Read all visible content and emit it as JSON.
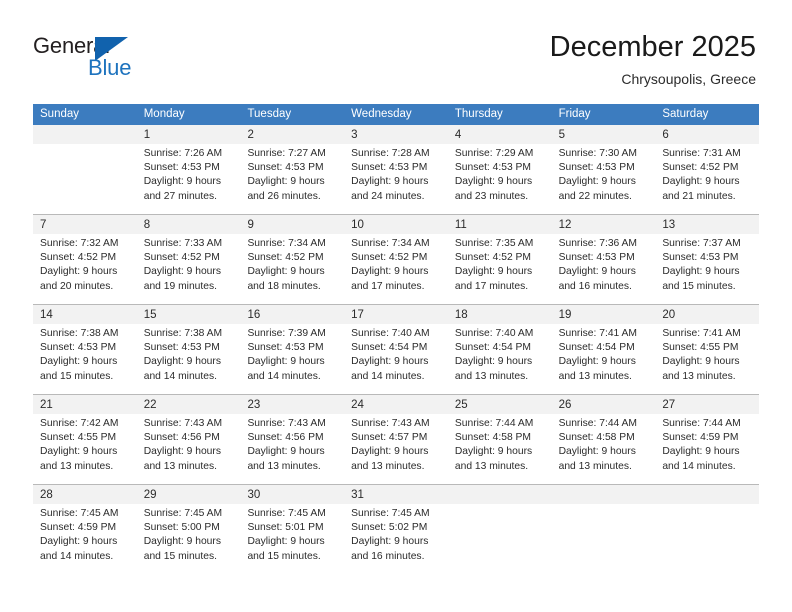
{
  "logo": {
    "text_primary": "General",
    "text_secondary": "Blue",
    "triangle_icon": "triangle-icon",
    "brand_blue": "#1e73be",
    "brand_dark": "#231f20"
  },
  "header": {
    "title": "December 2025",
    "subtitle": "Chrysoupolis, Greece"
  },
  "theme": {
    "header_row_bg": "#3c7cbf",
    "header_row_text": "#ffffff",
    "day_band_bg": "#f2f2f2",
    "grid_line": "#b9b9b9",
    "body_text": "#2b2b2b"
  },
  "calendar": {
    "day_headers": [
      "Sunday",
      "Monday",
      "Tuesday",
      "Wednesday",
      "Thursday",
      "Friday",
      "Saturday"
    ],
    "weeks": [
      [
        {
          "day": "",
          "lines": []
        },
        {
          "day": "1",
          "lines": [
            "Sunrise: 7:26 AM",
            "Sunset: 4:53 PM",
            "Daylight: 9 hours",
            "and 27 minutes."
          ]
        },
        {
          "day": "2",
          "lines": [
            "Sunrise: 7:27 AM",
            "Sunset: 4:53 PM",
            "Daylight: 9 hours",
            "and 26 minutes."
          ]
        },
        {
          "day": "3",
          "lines": [
            "Sunrise: 7:28 AM",
            "Sunset: 4:53 PM",
            "Daylight: 9 hours",
            "and 24 minutes."
          ]
        },
        {
          "day": "4",
          "lines": [
            "Sunrise: 7:29 AM",
            "Sunset: 4:53 PM",
            "Daylight: 9 hours",
            "and 23 minutes."
          ]
        },
        {
          "day": "5",
          "lines": [
            "Sunrise: 7:30 AM",
            "Sunset: 4:53 PM",
            "Daylight: 9 hours",
            "and 22 minutes."
          ]
        },
        {
          "day": "6",
          "lines": [
            "Sunrise: 7:31 AM",
            "Sunset: 4:52 PM",
            "Daylight: 9 hours",
            "and 21 minutes."
          ]
        }
      ],
      [
        {
          "day": "7",
          "lines": [
            "Sunrise: 7:32 AM",
            "Sunset: 4:52 PM",
            "Daylight: 9 hours",
            "and 20 minutes."
          ]
        },
        {
          "day": "8",
          "lines": [
            "Sunrise: 7:33 AM",
            "Sunset: 4:52 PM",
            "Daylight: 9 hours",
            "and 19 minutes."
          ]
        },
        {
          "day": "9",
          "lines": [
            "Sunrise: 7:34 AM",
            "Sunset: 4:52 PM",
            "Daylight: 9 hours",
            "and 18 minutes."
          ]
        },
        {
          "day": "10",
          "lines": [
            "Sunrise: 7:34 AM",
            "Sunset: 4:52 PM",
            "Daylight: 9 hours",
            "and 17 minutes."
          ]
        },
        {
          "day": "11",
          "lines": [
            "Sunrise: 7:35 AM",
            "Sunset: 4:52 PM",
            "Daylight: 9 hours",
            "and 17 minutes."
          ]
        },
        {
          "day": "12",
          "lines": [
            "Sunrise: 7:36 AM",
            "Sunset: 4:53 PM",
            "Daylight: 9 hours",
            "and 16 minutes."
          ]
        },
        {
          "day": "13",
          "lines": [
            "Sunrise: 7:37 AM",
            "Sunset: 4:53 PM",
            "Daylight: 9 hours",
            "and 15 minutes."
          ]
        }
      ],
      [
        {
          "day": "14",
          "lines": [
            "Sunrise: 7:38 AM",
            "Sunset: 4:53 PM",
            "Daylight: 9 hours",
            "and 15 minutes."
          ]
        },
        {
          "day": "15",
          "lines": [
            "Sunrise: 7:38 AM",
            "Sunset: 4:53 PM",
            "Daylight: 9 hours",
            "and 14 minutes."
          ]
        },
        {
          "day": "16",
          "lines": [
            "Sunrise: 7:39 AM",
            "Sunset: 4:53 PM",
            "Daylight: 9 hours",
            "and 14 minutes."
          ]
        },
        {
          "day": "17",
          "lines": [
            "Sunrise: 7:40 AM",
            "Sunset: 4:54 PM",
            "Daylight: 9 hours",
            "and 14 minutes."
          ]
        },
        {
          "day": "18",
          "lines": [
            "Sunrise: 7:40 AM",
            "Sunset: 4:54 PM",
            "Daylight: 9 hours",
            "and 13 minutes."
          ]
        },
        {
          "day": "19",
          "lines": [
            "Sunrise: 7:41 AM",
            "Sunset: 4:54 PM",
            "Daylight: 9 hours",
            "and 13 minutes."
          ]
        },
        {
          "day": "20",
          "lines": [
            "Sunrise: 7:41 AM",
            "Sunset: 4:55 PM",
            "Daylight: 9 hours",
            "and 13 minutes."
          ]
        }
      ],
      [
        {
          "day": "21",
          "lines": [
            "Sunrise: 7:42 AM",
            "Sunset: 4:55 PM",
            "Daylight: 9 hours",
            "and 13 minutes."
          ]
        },
        {
          "day": "22",
          "lines": [
            "Sunrise: 7:43 AM",
            "Sunset: 4:56 PM",
            "Daylight: 9 hours",
            "and 13 minutes."
          ]
        },
        {
          "day": "23",
          "lines": [
            "Sunrise: 7:43 AM",
            "Sunset: 4:56 PM",
            "Daylight: 9 hours",
            "and 13 minutes."
          ]
        },
        {
          "day": "24",
          "lines": [
            "Sunrise: 7:43 AM",
            "Sunset: 4:57 PM",
            "Daylight: 9 hours",
            "and 13 minutes."
          ]
        },
        {
          "day": "25",
          "lines": [
            "Sunrise: 7:44 AM",
            "Sunset: 4:58 PM",
            "Daylight: 9 hours",
            "and 13 minutes."
          ]
        },
        {
          "day": "26",
          "lines": [
            "Sunrise: 7:44 AM",
            "Sunset: 4:58 PM",
            "Daylight: 9 hours",
            "and 13 minutes."
          ]
        },
        {
          "day": "27",
          "lines": [
            "Sunrise: 7:44 AM",
            "Sunset: 4:59 PM",
            "Daylight: 9 hours",
            "and 14 minutes."
          ]
        }
      ],
      [
        {
          "day": "28",
          "lines": [
            "Sunrise: 7:45 AM",
            "Sunset: 4:59 PM",
            "Daylight: 9 hours",
            "and 14 minutes."
          ]
        },
        {
          "day": "29",
          "lines": [
            "Sunrise: 7:45 AM",
            "Sunset: 5:00 PM",
            "Daylight: 9 hours",
            "and 15 minutes."
          ]
        },
        {
          "day": "30",
          "lines": [
            "Sunrise: 7:45 AM",
            "Sunset: 5:01 PM",
            "Daylight: 9 hours",
            "and 15 minutes."
          ]
        },
        {
          "day": "31",
          "lines": [
            "Sunrise: 7:45 AM",
            "Sunset: 5:02 PM",
            "Daylight: 9 hours",
            "and 16 minutes."
          ]
        },
        {
          "day": "",
          "lines": []
        },
        {
          "day": "",
          "lines": []
        },
        {
          "day": "",
          "lines": []
        }
      ]
    ]
  }
}
